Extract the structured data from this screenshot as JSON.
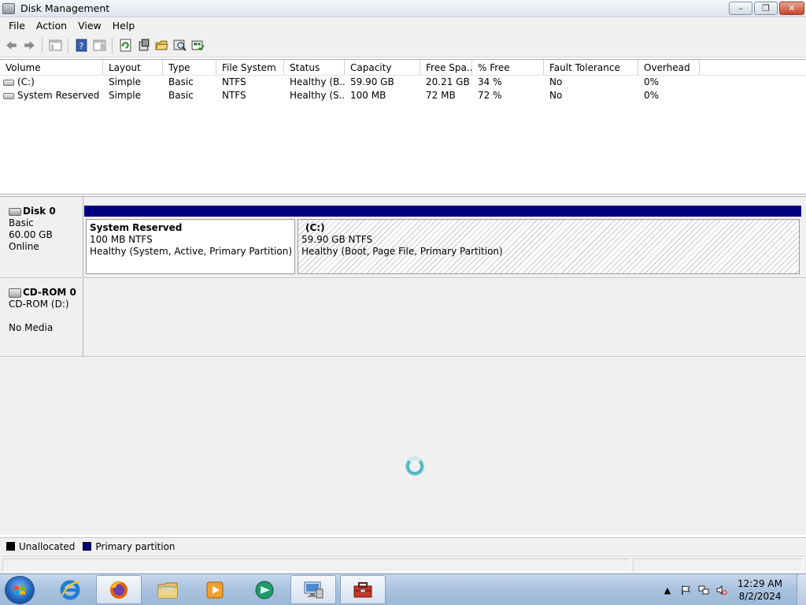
{
  "window": {
    "title": "Disk Management"
  },
  "menu": {
    "items": [
      "File",
      "Action",
      "View",
      "Help"
    ]
  },
  "volume_list": {
    "columns": [
      "Volume",
      "Layout",
      "Type",
      "File System",
      "Status",
      "Capacity",
      "Free Spa...",
      "% Free",
      "Fault Tolerance",
      "Overhead"
    ],
    "rows": [
      [
        "(C:)",
        "Simple",
        "Basic",
        "NTFS",
        "Healthy (B...",
        "59.90 GB",
        "20.21 GB",
        "34 %",
        "No",
        "0%"
      ],
      [
        "System Reserved",
        "Simple",
        "Basic",
        "NTFS",
        "Healthy (S...",
        "100 MB",
        "72 MB",
        "72 %",
        "No",
        "0%"
      ]
    ]
  },
  "disks": [
    {
      "name": "Disk 0",
      "lines": [
        "Basic",
        "60.00 GB",
        "Online"
      ],
      "partitions": [
        {
          "name": "System Reserved",
          "size": "100 MB NTFS",
          "status": "Healthy (System, Active, Primary Partition)"
        },
        {
          "name": "(C:)",
          "size": "59.90 GB NTFS",
          "status": "Healthy (Boot, Page File, Primary Partition)"
        }
      ]
    },
    {
      "name": "CD-ROM 0",
      "lines": [
        "CD-ROM (D:)",
        "",
        "No Media"
      ]
    }
  ],
  "legend": {
    "items": [
      {
        "label": "Unallocated",
        "color": "#000000"
      },
      {
        "label": "Primary partition",
        "color": "#000080"
      }
    ]
  },
  "taskbar": {
    "apps": [
      "internet-explorer",
      "firefox",
      "file-explorer",
      "media-player",
      "app-green-circle",
      "remote-desktop",
      "computer-management"
    ],
    "clock": {
      "time": "12:29 AM",
      "date": "8/2/2024"
    }
  },
  "colors": {
    "primary_partition": "#000080",
    "taskbar": "#a8c1de"
  }
}
